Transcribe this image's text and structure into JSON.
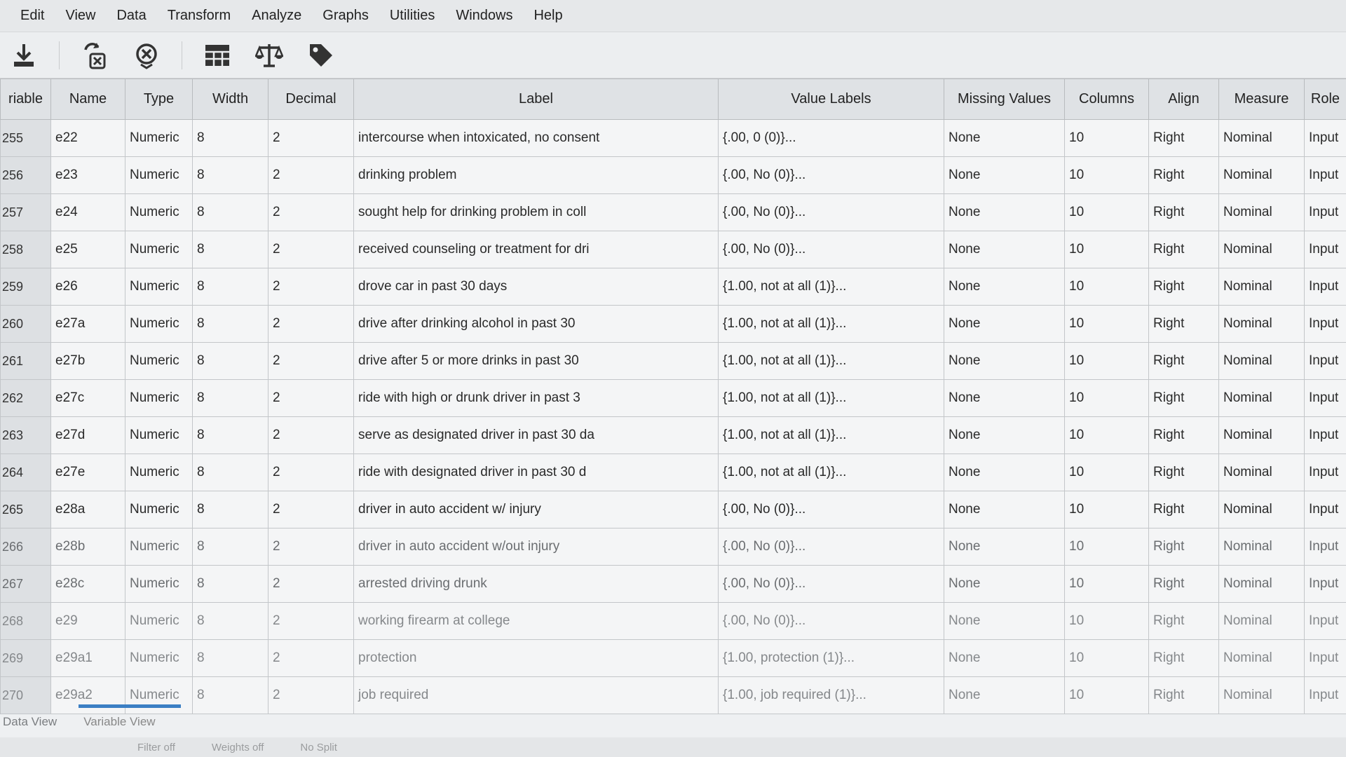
{
  "menu": [
    "Edit",
    "View",
    "Data",
    "Transform",
    "Analyze",
    "Graphs",
    "Utilities",
    "Windows",
    "Help"
  ],
  "toolbar": [
    "save-icon",
    "variable-icon",
    "delete-icon",
    "data-table-icon",
    "scale-balance-icon",
    "tag-icon"
  ],
  "columns": [
    "riable",
    "Name",
    "Type",
    "Width",
    "Decimal",
    "Label",
    "Value Labels",
    "Missing Values",
    "Columns",
    "Align",
    "Measure",
    "Role"
  ],
  "rows": [
    {
      "num": "255",
      "name": "e22",
      "type": "Numeric",
      "width": "8",
      "decimal": "2",
      "label": "intercourse when intoxicated, no consent",
      "value_labels": "{.00, 0     (0)}...",
      "missing": "None",
      "columns": "10",
      "align": "Right",
      "measure": "Nominal",
      "role": "Input"
    },
    {
      "num": "256",
      "name": "e23",
      "type": "Numeric",
      "width": "8",
      "decimal": "2",
      "label": "drinking problem",
      "value_labels": "{.00, No     (0)}...",
      "missing": "None",
      "columns": "10",
      "align": "Right",
      "measure": "Nominal",
      "role": "Input"
    },
    {
      "num": "257",
      "name": "e24",
      "type": "Numeric",
      "width": "8",
      "decimal": "2",
      "label": "sought help for drinking problem in coll",
      "value_labels": "{.00, No     (0)}...",
      "missing": "None",
      "columns": "10",
      "align": "Right",
      "measure": "Nominal",
      "role": "Input"
    },
    {
      "num": "258",
      "name": "e25",
      "type": "Numeric",
      "width": "8",
      "decimal": "2",
      "label": "received counseling or treatment for dri",
      "value_labels": "{.00, No     (0)}...",
      "missing": "None",
      "columns": "10",
      "align": "Right",
      "measure": "Nominal",
      "role": "Input"
    },
    {
      "num": "259",
      "name": "e26",
      "type": "Numeric",
      "width": "8",
      "decimal": "2",
      "label": "drove car in past 30 days",
      "value_labels": "{1.00, not at all        (1)}...",
      "missing": "None",
      "columns": "10",
      "align": "Right",
      "measure": "Nominal",
      "role": "Input"
    },
    {
      "num": "260",
      "name": "e27a",
      "type": "Numeric",
      "width": "8",
      "decimal": "2",
      "label": "drive after drinking alcohol in past 30",
      "value_labels": "{1.00, not at all   (1)}...",
      "missing": "None",
      "columns": "10",
      "align": "Right",
      "measure": "Nominal",
      "role": "Input"
    },
    {
      "num": "261",
      "name": "e27b",
      "type": "Numeric",
      "width": "8",
      "decimal": "2",
      "label": "drive after 5 or more drinks in past 30",
      "value_labels": "{1.00, not at all   (1)}...",
      "missing": "None",
      "columns": "10",
      "align": "Right",
      "measure": "Nominal",
      "role": "Input"
    },
    {
      "num": "262",
      "name": "e27c",
      "type": "Numeric",
      "width": "8",
      "decimal": "2",
      "label": "ride with high or drunk driver in past 3",
      "value_labels": "{1.00, not at all   (1)}...",
      "missing": "None",
      "columns": "10",
      "align": "Right",
      "measure": "Nominal",
      "role": "Input"
    },
    {
      "num": "263",
      "name": "e27d",
      "type": "Numeric",
      "width": "8",
      "decimal": "2",
      "label": "serve as designated driver in past 30 da",
      "value_labels": "{1.00, not at all   (1)}...",
      "missing": "None",
      "columns": "10",
      "align": "Right",
      "measure": "Nominal",
      "role": "Input"
    },
    {
      "num": "264",
      "name": "e27e",
      "type": "Numeric",
      "width": "8",
      "decimal": "2",
      "label": "ride with designated driver in past 30 d",
      "value_labels": "{1.00, not at all   (1)}...",
      "missing": "None",
      "columns": "10",
      "align": "Right",
      "measure": "Nominal",
      "role": "Input"
    },
    {
      "num": "265",
      "name": "e28a",
      "type": "Numeric",
      "width": "8",
      "decimal": "2",
      "label": "driver in auto accident w/ injury",
      "value_labels": "{.00, No     (0)}...",
      "missing": "None",
      "columns": "10",
      "align": "Right",
      "measure": "Nominal",
      "role": "Input"
    },
    {
      "num": "266",
      "name": "e28b",
      "type": "Numeric",
      "width": "8",
      "decimal": "2",
      "label": "driver in auto accident w/out injury",
      "value_labels": "{.00, No     (0)}...",
      "missing": "None",
      "columns": "10",
      "align": "Right",
      "measure": "Nominal",
      "role": "Input"
    },
    {
      "num": "267",
      "name": "e28c",
      "type": "Numeric",
      "width": "8",
      "decimal": "2",
      "label": "arrested driving drunk",
      "value_labels": "{.00, No     (0)}...",
      "missing": "None",
      "columns": "10",
      "align": "Right",
      "measure": "Nominal",
      "role": "Input"
    },
    {
      "num": "268",
      "name": "e29",
      "type": "Numeric",
      "width": "8",
      "decimal": "2",
      "label": "working firearm at college",
      "value_labels": "{.00, No     (0)}...",
      "missing": "None",
      "columns": "10",
      "align": "Right",
      "measure": "Nominal",
      "role": "Input"
    },
    {
      "num": "269",
      "name": "e29a1",
      "type": "Numeric",
      "width": "8",
      "decimal": "2",
      "label": "protection",
      "value_labels": "{1.00, protection   (1)}...",
      "missing": "None",
      "columns": "10",
      "align": "Right",
      "measure": "Nominal",
      "role": "Input"
    },
    {
      "num": "270",
      "name": "e29a2",
      "type": "Numeric",
      "width": "8",
      "decimal": "2",
      "label": "job required",
      "value_labels": "{1.00, job required (1)}...",
      "missing": "None",
      "columns": "10",
      "align": "Right",
      "measure": "Nominal",
      "role": "Input"
    }
  ],
  "tabs": {
    "data_view": "Data View",
    "variable_view": "Variable View"
  },
  "status": {
    "filter": "Filter off",
    "weights": "Weights off",
    "split": "No Split"
  }
}
